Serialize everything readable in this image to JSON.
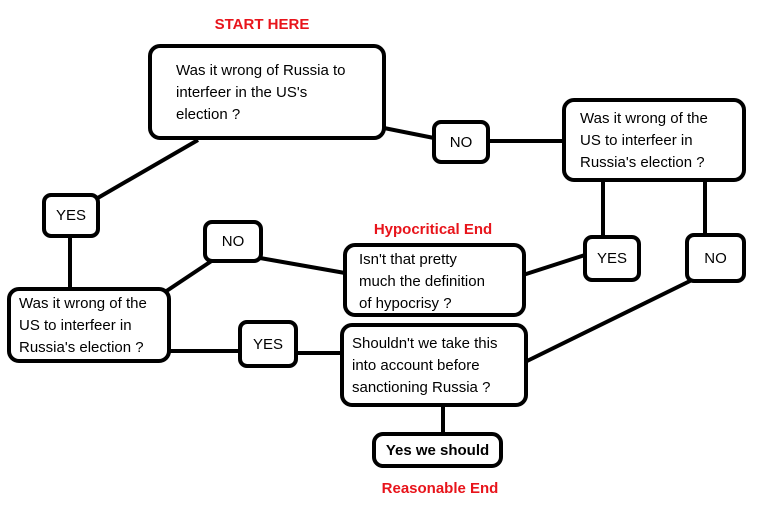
{
  "colors": {
    "accent": "#e8141b",
    "stroke": "#000000"
  },
  "labels": {
    "start": "START HERE",
    "hypocritical_end": "Hypocritical End",
    "reasonable_end": "Reasonable End"
  },
  "nodes": {
    "q1": [
      "Was it wrong of Russia to",
      "interfeer in the US's",
      "election ?"
    ],
    "q2": [
      "Was it wrong of the",
      "US to interfeer in",
      "Russia's election ?"
    ],
    "q3": [
      "Was it wrong of the",
      "US to interfeer in",
      "Russia's election ?"
    ],
    "hypocrisy": [
      "Isn't that pretty",
      "much the definition",
      "of hypocrisy ?"
    ],
    "sanction": [
      "Shouldn't we take this",
      "into account before",
      "sanctioning Russia ?"
    ],
    "final": "Yes we should"
  },
  "edges": {
    "q1_no": "NO",
    "q1_yes": "YES",
    "q2_yes": "YES",
    "q2_no": "NO",
    "q3_no": "NO",
    "q3_yes": "YES"
  }
}
